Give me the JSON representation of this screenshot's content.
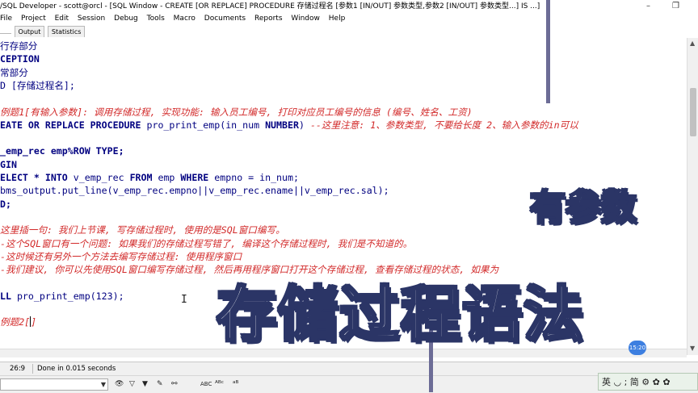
{
  "window": {
    "title": "/SQL Developer - scott@orcl - [SQL Window - CREATE [OR REPLACE] PROCEDURE 存储过程名 [参数1 [IN/OUT] 参数类型,参数2 [IN/OUT] 参数类型...] IS ...]",
    "minimize_glyph": "–",
    "restore_glyph": "❐"
  },
  "menu": [
    "File",
    "Project",
    "Edit",
    "Session",
    "Debug",
    "Tools",
    "Macro",
    "Documents",
    "Reports",
    "Window",
    "Help"
  ],
  "tabs": [
    {
      "label": "",
      "active": true
    },
    {
      "label": "Output",
      "active": false
    },
    {
      "label": "Statistics",
      "active": false
    }
  ],
  "editor": {
    "lines": [
      {
        "segments": [
          {
            "t": "行存部分",
            "s": "nm"
          }
        ]
      },
      {
        "segments": [
          {
            "t": "CEPTION",
            "s": "kw"
          }
        ]
      },
      {
        "segments": [
          {
            "t": "常部分",
            "s": "nm"
          }
        ]
      },
      {
        "segments": [
          {
            "t": "D [存储过程名];",
            "s": "pl"
          }
        ]
      },
      {
        "segments": []
      },
      {
        "segments": [
          {
            "t": "例题1[有输入参数]: 调用存储过程, 实现功能: 输入员工编号, 打印对应员工编号的信息 (编号、姓名、工资)",
            "s": "cm"
          }
        ]
      },
      {
        "segments": [
          {
            "t": "EATE OR REPLACE PROCEDURE ",
            "s": "kw"
          },
          {
            "t": "pro_print_emp(in_num ",
            "s": "pl"
          },
          {
            "t": "NUMBER",
            "s": "kw"
          },
          {
            "t": ") ",
            "s": "pl"
          },
          {
            "t": "--这里注意: 1、参数类型, 不要给长度 2、输入参数的in可以",
            "s": "cm"
          }
        ]
      },
      {
        "segments": []
      },
      {
        "segments": [
          {
            "t": "_emp_rec emp%ROW TYPE;",
            "s": "kw"
          }
        ]
      },
      {
        "segments": [
          {
            "t": "GIN",
            "s": "kw"
          }
        ]
      },
      {
        "segments": [
          {
            "t": "ELECT * INTO ",
            "s": "kw"
          },
          {
            "t": "v_emp_rec ",
            "s": "pl"
          },
          {
            "t": "FROM ",
            "s": "kw"
          },
          {
            "t": "emp ",
            "s": "pl"
          },
          {
            "t": "WHERE ",
            "s": "kw"
          },
          {
            "t": "empno = in_num;",
            "s": "pl"
          }
        ]
      },
      {
        "segments": [
          {
            "t": "bms_output.put_line(v_emp_rec.empno||v_emp_rec.ename||v_emp_rec.sal);",
            "s": "pl"
          }
        ]
      },
      {
        "segments": [
          {
            "t": "D;",
            "s": "kw"
          }
        ]
      },
      {
        "segments": []
      },
      {
        "segments": [
          {
            "t": "这里插一句: 我们上节课, 写存储过程时, 使用的是SQL窗口编写。",
            "s": "cm"
          }
        ]
      },
      {
        "segments": [
          {
            "t": "-这个SQL窗口有一个问题: 如果我们的存储过程写错了, 编译这个存储过程时, 我们是不知道的。",
            "s": "cm"
          }
        ]
      },
      {
        "segments": [
          {
            "t": "-这时候还有另外一个方法去编写存储过程: 使用程序窗口",
            "s": "cm"
          }
        ]
      },
      {
        "segments": [
          {
            "t": "-我们建议, 你可以先使用SQL窗口编写存储过程, 然后再用程序窗口打开这个存储过程, 查看存储过程的状态, 如果为",
            "s": "cm"
          }
        ]
      },
      {
        "segments": []
      },
      {
        "segments": [
          {
            "t": "LL ",
            "s": "kw"
          },
          {
            "t": "pro_print_emp(123);",
            "s": "pl"
          }
        ]
      },
      {
        "segments": []
      },
      {
        "segments": [
          {
            "t": "例题2[",
            "s": "cm"
          },
          {
            "t": "|",
            "s": "caret"
          },
          {
            "t": "]",
            "s": "cm"
          }
        ]
      }
    ]
  },
  "status": {
    "position": "26:9",
    "message": "Done in 0.015 seconds"
  },
  "toolbar": {
    "icons": [
      "binoculars-icon",
      "filter-icon",
      "filter-active-icon",
      "edit-icon",
      "link-icon",
      "abc-icon",
      "spell-icon",
      "abc-ab-icon"
    ],
    "labels": [
      "👁",
      "▽",
      "▼",
      "✎",
      "⚯",
      "ABC",
      "ᴬᴮᶜ",
      "ᵃᴮ"
    ]
  },
  "overlay": {
    "big_caption": "存储过程语法",
    "small_caption": "有参数",
    "time_bubble": "15:20"
  },
  "ime": {
    "text": "英 ◡ ; 简 ⚙ ✿ ✿"
  }
}
